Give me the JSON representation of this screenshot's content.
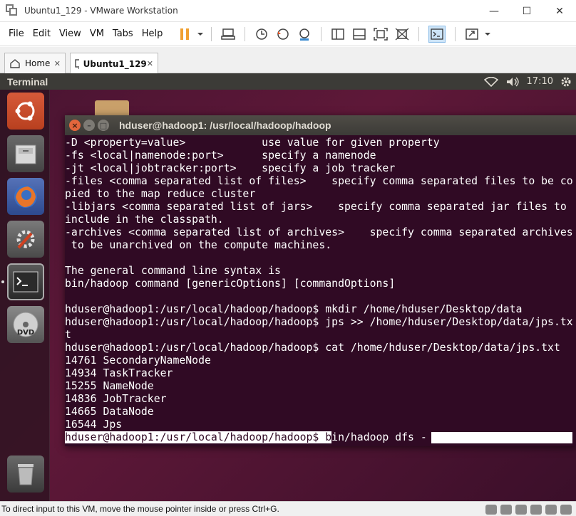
{
  "window": {
    "title": "Ubuntu1_129 - VMware Workstation",
    "minimize_glyph": "—",
    "maximize_glyph": "☐",
    "close_glyph": "✕"
  },
  "menu": {
    "items": [
      "File",
      "Edit",
      "View",
      "VM",
      "Tabs",
      "Help"
    ]
  },
  "tabs": {
    "home_label": "Home",
    "vm_label": "Ubuntu1_129",
    "close_glyph": "✕"
  },
  "ubuntu_panel": {
    "title": "Terminal",
    "clock": "17:10",
    "wifi_icon": "wifi-icon",
    "sound_icon": "speaker-icon",
    "settings_icon": "gear-icon"
  },
  "launcher": {
    "items": [
      "ubuntu-dash",
      "files",
      "firefox",
      "system-settings",
      "terminal",
      "dvd",
      "trash"
    ]
  },
  "terminal": {
    "title": "hduser@hadoop1: /usr/local/hadoop/hadoop",
    "lines": [
      "-D <property=value>            use value for given property",
      "-fs <local|namenode:port>      specify a namenode",
      "-jt <local|jobtracker:port>    specify a job tracker",
      "-files <comma separated list of files>    specify comma separated files to be co",
      "pied to the map reduce cluster",
      "-libjars <comma separated list of jars>    specify comma separated jar files to",
      "include in the classpath.",
      "-archives <comma separated list of archives>    specify comma separated archives",
      " to be unarchived on the compute machines.",
      "",
      "The general command line syntax is",
      "bin/hadoop command [genericOptions] [commandOptions]",
      "",
      "hduser@hadoop1:/usr/local/hadoop/hadoop$ mkdir /home/hduser/Desktop/data",
      "hduser@hadoop1:/usr/local/hadoop/hadoop$ jps >> /home/hduser/Desktop/data/jps.tx",
      "t",
      "hduser@hadoop1:/usr/local/hadoop/hadoop$ cat /home/hduser/Desktop/data/jps.txt",
      "14761 SecondaryNameNode",
      "14934 TaskTracker",
      "15255 NameNode",
      "14836 JobTracker",
      "14665 DataNode",
      "16544 Jps"
    ],
    "prompt_line": "hduser@hadoop1:/usr/local/hadoop/hadoop$ bin/hadoop dfs -"
  },
  "status_bar": {
    "text": "To direct input to this VM, move the mouse pointer inside or press Ctrl+G."
  },
  "colors": {
    "terminal_bg": "#300a24",
    "ubuntu_panel": "#3c3b37",
    "close_orange": "#e2663c",
    "pause_orange": "#f0a030"
  }
}
